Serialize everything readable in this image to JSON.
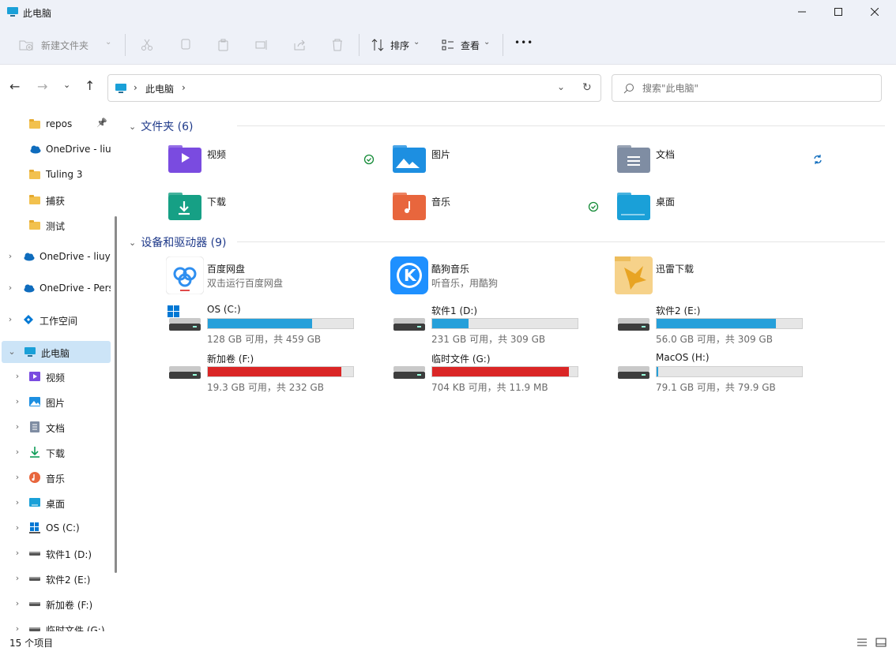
{
  "window": {
    "title": "此电脑",
    "min_icon": "minimize-icon",
    "max_icon": "maximize-icon",
    "close_icon": "close-icon"
  },
  "toolbar": {
    "new_folder": "新建文件夹",
    "sort": "排序",
    "view": "查看",
    "more": "•••"
  },
  "nav": {
    "path": "此电脑",
    "search_placeholder": "搜索\"此电脑\""
  },
  "sidebar": {
    "items": [
      {
        "label": "repos",
        "icon": "folder-icon",
        "pinned": true
      },
      {
        "label": "OneDrive - liu",
        "icon": "onedrive-icon"
      },
      {
        "label": "Tuling 3",
        "icon": "folder-icon"
      },
      {
        "label": "捕获",
        "icon": "folder-icon"
      },
      {
        "label": "测试",
        "icon": "folder-icon"
      },
      {
        "label": "OneDrive - liuy",
        "icon": "onedrive-icon"
      },
      {
        "label": "OneDrive - Pers",
        "icon": "onedrive-icon"
      },
      {
        "label": "工作空间",
        "icon": "workspace-icon"
      },
      {
        "label": "此电脑",
        "icon": "pc-icon"
      },
      {
        "label": "视频",
        "icon": "video-icon"
      },
      {
        "label": "图片",
        "icon": "picture-icon"
      },
      {
        "label": "文档",
        "icon": "document-icon"
      },
      {
        "label": "下载",
        "icon": "download-icon"
      },
      {
        "label": "音乐",
        "icon": "music-icon"
      },
      {
        "label": "桌面",
        "icon": "desktop-icon"
      },
      {
        "label": "OS (C:)",
        "icon": "windows-drive-icon"
      },
      {
        "label": "软件1 (D:)",
        "icon": "drive-icon"
      },
      {
        "label": "软件2 (E:)",
        "icon": "drive-icon"
      },
      {
        "label": "新加卷 (F:)",
        "icon": "drive-icon"
      },
      {
        "label": "临时文件 (G:)",
        "icon": "drive-icon"
      }
    ]
  },
  "folders_section": {
    "title": "文件夹 (6)",
    "items": [
      {
        "label": "视频",
        "status": "synced"
      },
      {
        "label": "图片",
        "status": ""
      },
      {
        "label": "文档",
        "status": "syncing"
      },
      {
        "label": "下载",
        "status": ""
      },
      {
        "label": "音乐",
        "status": "synced"
      },
      {
        "label": "桌面",
        "status": ""
      }
    ]
  },
  "devices_section": {
    "title": "设备和驱动器 (9)",
    "apps": [
      {
        "name": "百度网盘",
        "sub": "双击运行百度网盘"
      },
      {
        "name": "酷狗音乐",
        "sub": "听音乐，用酷狗"
      },
      {
        "name": "迅雷下载",
        "sub": ""
      }
    ],
    "drives": [
      {
        "name": "OS (C:)",
        "free": "128 GB 可用，共 459 GB",
        "used_fraction": 0.72,
        "color": "#26a0da"
      },
      {
        "name": "软件1 (D:)",
        "free": "231 GB 可用，共 309 GB",
        "used_fraction": 0.25,
        "color": "#26a0da"
      },
      {
        "name": "软件2 (E:)",
        "free": "56.0 GB 可用，共 309 GB",
        "used_fraction": 0.82,
        "color": "#26a0da"
      },
      {
        "name": "新加卷 (F:)",
        "free": "19.3 GB 可用，共 232 GB",
        "used_fraction": 0.92,
        "color": "#da2626"
      },
      {
        "name": "临时文件 (G:)",
        "free": "704 KB 可用，共 11.9 MB",
        "used_fraction": 0.94,
        "color": "#da2626"
      },
      {
        "name": "MacOS (H:)",
        "free": "79.1 GB 可用，共 79.9 GB",
        "used_fraction": 0.01,
        "color": "#26a0da"
      }
    ]
  },
  "statusbar": {
    "count": "15 个项目"
  }
}
